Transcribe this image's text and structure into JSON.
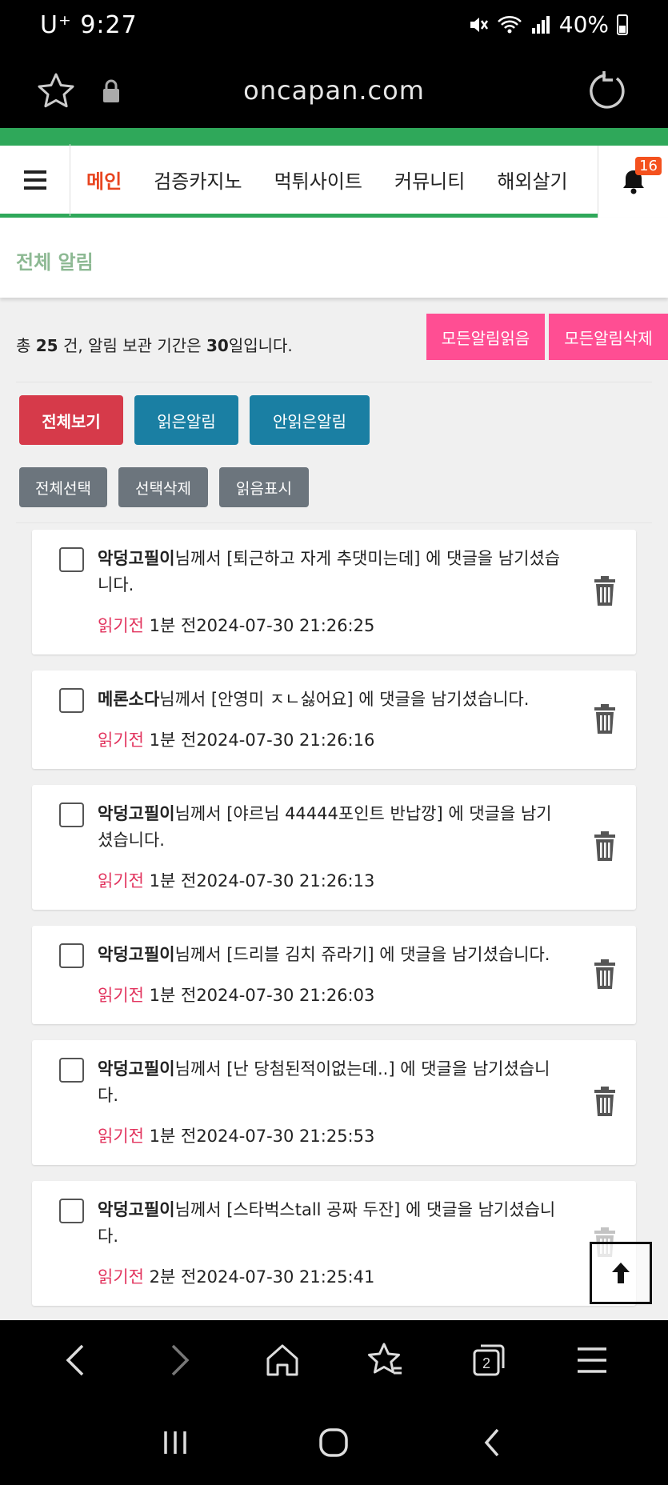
{
  "status_bar": {
    "carrier_time": "U⁺ 9:27",
    "battery": "40%"
  },
  "browser": {
    "url": "oncapan.com"
  },
  "nav": {
    "items": [
      "메인",
      "검증카지노",
      "먹튀사이트",
      "커뮤니티",
      "해외살기"
    ],
    "active_index": 0,
    "bell_count": "16"
  },
  "page": {
    "title": "전체 알림",
    "summary": {
      "prefix": "총 ",
      "count": "25",
      "mid": " 건, 알림 보관 기간은 ",
      "days": "30",
      "suffix": "일입니다."
    },
    "buttons": {
      "read_all": "모든알림읽음",
      "delete_all": "모든알림삭제",
      "view_all": "전체보기",
      "read": "읽은알림",
      "unread": "안읽은알림",
      "select_all": "전체선택",
      "delete_selected": "선택삭제",
      "mark_read": "읽음표시"
    }
  },
  "notifications": [
    {
      "user": "악덩고필이",
      "text": "님께서 [퇴근하고 자게 추댓미는데] 에 댓글을 남기셨습니다.",
      "status": "읽기전",
      "time": " 1분 전2024-07-30 21:26:25"
    },
    {
      "user": "메론소다",
      "text": "님께서 [안영미 ㅈㄴ싫어요] 에 댓글을 남기셨습니다.",
      "status": "읽기전",
      "time": " 1분 전2024-07-30 21:26:16"
    },
    {
      "user": "악덩고필이",
      "text": "님께서 [야르님 44444포인트 반납깡] 에 댓글을 남기셨습니다.",
      "status": "읽기전",
      "time": " 1분 전2024-07-30 21:26:13"
    },
    {
      "user": "악덩고필이",
      "text": "님께서 [드리블 김치 쥬라기] 에 댓글을 남기셨습니다.",
      "status": "읽기전",
      "time": " 1분 전2024-07-30 21:26:03"
    },
    {
      "user": "악덩고필이",
      "text": "님께서 [난 당첨된적이없는데..] 에 댓글을 남기셨습니다.",
      "status": "읽기전",
      "time": " 1분 전2024-07-30 21:25:53"
    },
    {
      "user": "악덩고필이",
      "text": "님께서 [스타벅스tall 공짜 두잔] 에 댓글을 남기셨습니다.",
      "status": "읽기전",
      "time": " 2분 전2024-07-30 21:25:41"
    }
  ],
  "colors": {
    "accent_green": "#2fa85a",
    "active_nav": "#e8441f",
    "pink": "#ff4e93",
    "unread": "#e2345e"
  }
}
